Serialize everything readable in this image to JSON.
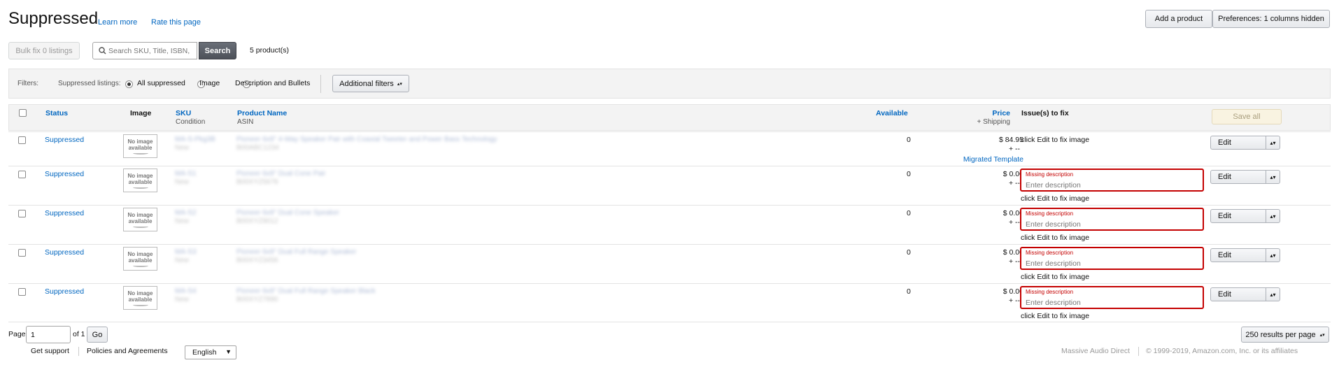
{
  "header": {
    "title": "Suppressed",
    "learn_more": "Learn more",
    "rate_page": "Rate this page",
    "add_product": "Add a product",
    "preferences": "Preferences: 1 columns hidden"
  },
  "toolbar": {
    "bulk_fix": "Bulk fix 0 listings",
    "search_placeholder": "Search SKU, Title, ISBN,",
    "search_button": "Search",
    "product_count": "5 product(s)"
  },
  "filters": {
    "label": "Filters:",
    "suppressed_label": "Suppressed listings:",
    "options": [
      "All suppressed",
      "Image",
      "Description and Bullets"
    ],
    "selected": "All suppressed",
    "additional": "Additional filters"
  },
  "table": {
    "headers": {
      "status": "Status",
      "image": "Image",
      "sku": "SKU",
      "condition": "Condition",
      "product_name": "Product Name",
      "asin": "ASIN",
      "available": "Available",
      "price": "Price",
      "shipping": "+ Shipping",
      "issues": "Issue(s) to fix",
      "save_all": "Save all"
    },
    "no_image_line1": "No image",
    "no_image_line2": "available",
    "rows": [
      {
        "status": "Suppressed",
        "sku": "MA-S-Pkg3B",
        "condition": "New",
        "name": "Pioneer 6x9\" 4-Way Speaker Pair with Coaxial Tweeter and Power Bass Technology",
        "asin": "B00ABC1234",
        "available": "0",
        "price": "$ 84.95",
        "shipping": "+ --",
        "template": "Migrated Template",
        "missing_label": "",
        "missing_placeholder": "",
        "issue": "click Edit to fix image",
        "edit": "Edit"
      },
      {
        "status": "Suppressed",
        "sku": "MA-S1",
        "condition": "New",
        "name": "Pioneer 6x9\" Dual Cone Pair",
        "asin": "B00XYZ5678",
        "available": "0",
        "price": "$ 0.00",
        "shipping": "+ --",
        "template": "",
        "missing_label": "Missing description",
        "missing_placeholder": "Enter description",
        "issue": "click Edit to fix image",
        "edit": "Edit"
      },
      {
        "status": "Suppressed",
        "sku": "MA-S2",
        "condition": "New",
        "name": "Pioneer 6x9\" Dual Cone Speaker",
        "asin": "B00XYZ9012",
        "available": "0",
        "price": "$ 0.00",
        "shipping": "+ --",
        "template": "",
        "missing_label": "Missing description",
        "missing_placeholder": "Enter description",
        "issue": "click Edit to fix image",
        "edit": "Edit"
      },
      {
        "status": "Suppressed",
        "sku": "MA-S3",
        "condition": "New",
        "name": "Pioneer 6x9\" Dual Full Range Speaker",
        "asin": "B00XYZ3456",
        "available": "0",
        "price": "$ 0.00",
        "shipping": "+ --",
        "template": "",
        "missing_label": "Missing description",
        "missing_placeholder": "Enter description",
        "issue": "click Edit to fix image",
        "edit": "Edit"
      },
      {
        "status": "Suppressed",
        "sku": "MA-S4",
        "condition": "New",
        "name": "Pioneer 6x9\" Dual Full Range Speaker Black",
        "asin": "B00XYZ7890",
        "available": "0",
        "price": "$ 0.00",
        "shipping": "+ --",
        "template": "",
        "missing_label": "Missing description",
        "missing_placeholder": "Enter description",
        "issue": "click Edit to fix image",
        "edit": "Edit"
      }
    ]
  },
  "pagination": {
    "page_label": "Page",
    "page_value": "1",
    "of_label": "of 1",
    "go": "Go",
    "per_page": "250 results per page"
  },
  "footer": {
    "support": "Get support",
    "policies": "Policies and Agreements",
    "language": "English",
    "seller": "Massive Audio Direct",
    "copyright": "© 1999-2019, Amazon.com, Inc. or its affiliates"
  }
}
